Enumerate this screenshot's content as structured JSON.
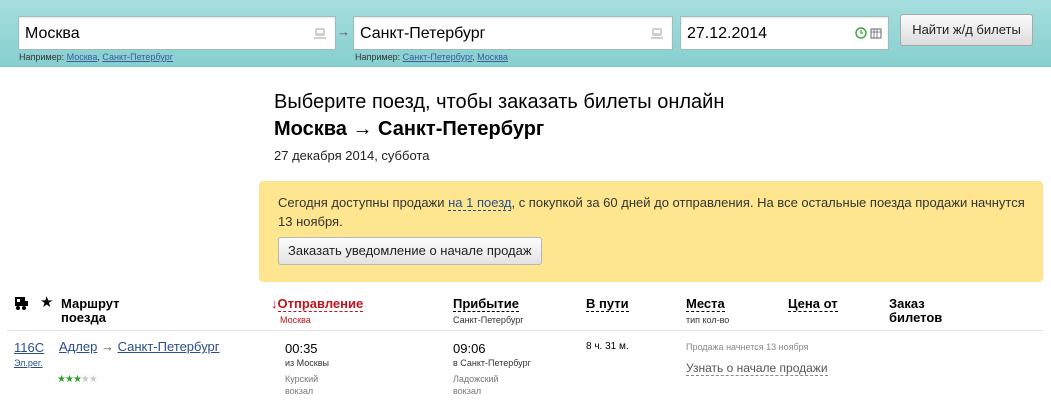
{
  "search": {
    "from_value": "Москва",
    "to_value": "Санкт-Петербург",
    "date_value": "27.12.2014",
    "find_button": "Найти ж/д билеты",
    "hint_label": "Например:",
    "from_hints": [
      "Москва",
      "Санкт-Петербург"
    ],
    "to_hints": [
      "Санкт-Петербург",
      "Москва"
    ],
    "arrow": "→"
  },
  "heading": {
    "line1": "Выберите поезд, чтобы заказать билеты онлайн",
    "route": "Москва → Санкт-Петербург",
    "date": "27 декабря 2014, суббота"
  },
  "notice": {
    "text_before": "Сегодня доступны продажи ",
    "link": "на 1 поезд",
    "text_after": ", с покупкой за 60 дней до отправления. На все остальные поезда продажи начнутся 13 ноября.",
    "button": "Заказать уведомление о начале продаж"
  },
  "table": {
    "headers": {
      "route": "Маршрут поезда",
      "departure": "Отправление",
      "departure_sub": "Москва",
      "arrival": "Прибытие",
      "arrival_sub": "Санкт-Петербург",
      "travel": "В пути",
      "seats": "Места",
      "seats_sub": "тип кол-во",
      "price": "Цена от",
      "order": "Заказ билетов",
      "sort_arrow": "↓"
    },
    "rows": [
      {
        "train_number": "116С",
        "train_type": "Эл.рег.",
        "route_from": "Адлер",
        "route_to": "Санкт-Петербург",
        "route_arrow": "→",
        "rating": 3,
        "rating_max": 5,
        "dep_time": "00:35",
        "dep_from": "из Москвы",
        "dep_station": "Курский вокзал",
        "arr_time": "09:06",
        "arr_to": "в Санкт-Петербург",
        "arr_station": "Ладожский вокзал",
        "duration": "8 ч. 31 м.",
        "sale_info": "Продажа начнется 13 ноября",
        "sale_link": "Узнать о начале продажи"
      }
    ]
  }
}
